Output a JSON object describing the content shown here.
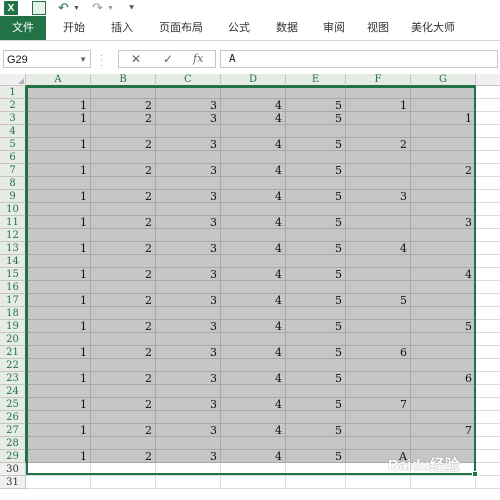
{
  "quick_access": {
    "app_icon": "excel-logo",
    "app_icon_text": "X",
    "save": "save-icon",
    "undo": "undo-icon",
    "redo": "redo-icon"
  },
  "ribbon": {
    "tabs": [
      "文件",
      "开始",
      "插入",
      "页面布局",
      "公式",
      "数据",
      "审阅",
      "视图",
      "美化大师"
    ],
    "active_tab": "文件",
    "accent": "#217346"
  },
  "formula_bar": {
    "name_box": "G29",
    "cancel_icon": "✕",
    "enter_icon": "✓",
    "fx_label": "fx",
    "content": "A"
  },
  "sheet": {
    "columns": [
      "A",
      "B",
      "C",
      "D",
      "E",
      "F",
      "G"
    ],
    "rows": [
      "1",
      "2",
      "3",
      "4",
      "5",
      "6",
      "7",
      "8",
      "9",
      "10",
      "11",
      "12",
      "13",
      "14",
      "15",
      "16",
      "17",
      "18",
      "19",
      "20",
      "21",
      "22",
      "23",
      "24",
      "25",
      "26",
      "27",
      "28",
      "29",
      "30",
      "31"
    ],
    "selected_range": "A1:G29",
    "selection_fill": "#c6c6c6",
    "cells": [
      [
        "",
        "",
        "",
        "",
        "",
        "",
        ""
      ],
      [
        "1",
        "2",
        "3",
        "4",
        "5",
        "1",
        ""
      ],
      [
        "1",
        "2",
        "3",
        "4",
        "5",
        "",
        "1"
      ],
      [
        "",
        "",
        "",
        "",
        "",
        "",
        ""
      ],
      [
        "1",
        "2",
        "3",
        "4",
        "5",
        "2",
        ""
      ],
      [
        "",
        "",
        "",
        "",
        "",
        "",
        ""
      ],
      [
        "1",
        "2",
        "3",
        "4",
        "5",
        "",
        "2"
      ],
      [
        "",
        "",
        "",
        "",
        "",
        "",
        ""
      ],
      [
        "1",
        "2",
        "3",
        "4",
        "5",
        "3",
        ""
      ],
      [
        "",
        "",
        "",
        "",
        "",
        "",
        ""
      ],
      [
        "1",
        "2",
        "3",
        "4",
        "5",
        "",
        "3"
      ],
      [
        "",
        "",
        "",
        "",
        "",
        "",
        ""
      ],
      [
        "1",
        "2",
        "3",
        "4",
        "5",
        "4",
        ""
      ],
      [
        "",
        "",
        "",
        "",
        "",
        "",
        ""
      ],
      [
        "1",
        "2",
        "3",
        "4",
        "5",
        "",
        "4"
      ],
      [
        "",
        "",
        "",
        "",
        "",
        "",
        ""
      ],
      [
        "1",
        "2",
        "3",
        "4",
        "5",
        "5",
        ""
      ],
      [
        "",
        "",
        "",
        "",
        "",
        "",
        ""
      ],
      [
        "1",
        "2",
        "3",
        "4",
        "5",
        "",
        "5"
      ],
      [
        "",
        "",
        "",
        "",
        "",
        "",
        ""
      ],
      [
        "1",
        "2",
        "3",
        "4",
        "5",
        "6",
        ""
      ],
      [
        "",
        "",
        "",
        "",
        "",
        "",
        ""
      ],
      [
        "1",
        "2",
        "3",
        "4",
        "5",
        "",
        "6"
      ],
      [
        "",
        "",
        "",
        "",
        "",
        "",
        ""
      ],
      [
        "1",
        "2",
        "3",
        "4",
        "5",
        "7",
        ""
      ],
      [
        "",
        "",
        "",
        "",
        "",
        "",
        ""
      ],
      [
        "1",
        "2",
        "3",
        "4",
        "5",
        "",
        "7"
      ],
      [
        "",
        "",
        "",
        "",
        "",
        "",
        ""
      ],
      [
        "1",
        "2",
        "3",
        "4",
        "5",
        "A",
        ""
      ],
      [
        "",
        "",
        "",
        "",
        "",
        "",
        ""
      ],
      [
        "",
        "",
        "",
        "",
        "",
        "",
        ""
      ]
    ]
  },
  "watermark": {
    "text": "Baidu经验"
  }
}
